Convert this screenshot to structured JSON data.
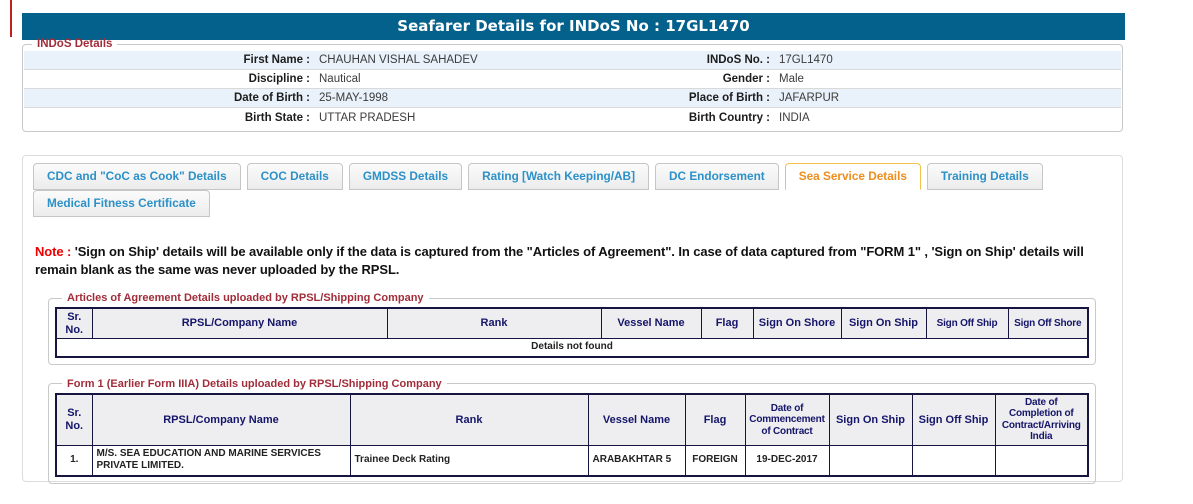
{
  "header": {
    "title": "Seafarer Details for INDoS No : 17GL1470"
  },
  "colors": {
    "title_bar": "#03618c",
    "legend_text": "#a22d3a",
    "tab_text": "#2b91c8",
    "tab_active_text": "#ee8e1e",
    "tab_active_border": "#f3c14b",
    "note_red": "#ee0000",
    "details_not_found_red": "#e00000",
    "table_border": "#15153f",
    "table_header_text": "#15156b",
    "row_stripe": "#e9f1fa"
  },
  "indos": {
    "legend": "INDoS Details",
    "rows": [
      {
        "l_label": "First Name :",
        "l_value": "CHAUHAN VISHAL SAHADEV",
        "r_label": "INDoS No. :",
        "r_value": "17GL1470"
      },
      {
        "l_label": "Discipline :",
        "l_value": "Nautical",
        "r_label": "Gender :",
        "r_value": "Male"
      },
      {
        "l_label": "Date of Birth :",
        "l_value": "25-MAY-1998",
        "r_label": "Place of Birth :",
        "r_value": "JAFARPUR"
      },
      {
        "l_label": "Birth State :",
        "l_value": "UTTAR PRADESH",
        "r_label": "Birth Country :",
        "r_value": "INDIA"
      }
    ]
  },
  "tabs": {
    "row1": [
      {
        "label": "CDC and \"CoC as Cook\" Details",
        "active": false
      },
      {
        "label": "COC Details",
        "active": false
      },
      {
        "label": "GMDSS Details",
        "active": false
      },
      {
        "label": "Rating [Watch Keeping/AB]",
        "active": false
      },
      {
        "label": "DC Endorsement",
        "active": false
      },
      {
        "label": "Sea Service Details",
        "active": true
      },
      {
        "label": "Training Details",
        "active": false
      }
    ],
    "row2": [
      {
        "label": "Medical Fitness Certificate",
        "active": false
      }
    ]
  },
  "note": {
    "prefix": "Note :",
    "text": " 'Sign on Ship' details will be available only if the data is captured from the \"Articles of Agreement\". In case of data captured from \"FORM 1\" , 'Sign on Ship' details will remain blank as the same was never uploaded by the RPSL."
  },
  "aoa_table": {
    "legend": "Articles of Agreement Details uploaded by RPSL/Shipping Company",
    "columns": [
      "Sr.\nNo.",
      "RPSL/Company Name",
      "Rank",
      "Vessel Name",
      "Flag",
      "Sign On Shore",
      "Sign On Ship",
      "Sign Off Ship",
      "Sign Off Shore"
    ],
    "empty_message": "Details not found"
  },
  "form1_table": {
    "legend": "Form 1 (Earlier Form IIIA) Details uploaded by RPSL/Shipping Company",
    "columns": [
      "Sr.\nNo.",
      "RPSL/Company Name",
      "Rank",
      "Vessel Name",
      "Flag",
      "Date of\nCommencement\nof Contract",
      "Sign On Ship",
      "Sign Off Ship",
      "Date of\nCompletion of\nContract/Arriving\nIndia"
    ],
    "rows": [
      [
        "1.",
        "M/S. SEA EDUCATION AND MARINE SERVICES PRIVATE LIMITED.",
        "Trainee Deck Rating",
        "ARABAKHTAR 5",
        "FOREIGN",
        "19-DEC-2017",
        "",
        "",
        ""
      ]
    ]
  }
}
